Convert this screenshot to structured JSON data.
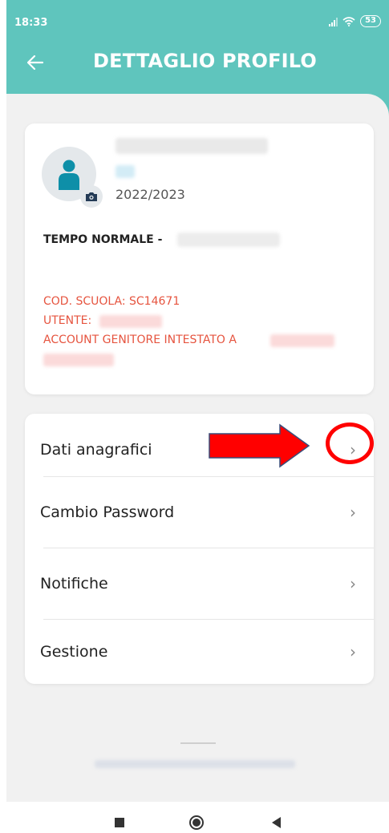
{
  "status_bar": {
    "time": "18:33",
    "battery": "53"
  },
  "app_bar": {
    "title": "DETTAGLIO PROFILO"
  },
  "profile": {
    "school_year": "2022/2023",
    "schedule_label": "TEMPO NORMALE -",
    "school_code": "COD. SCUOLA: SC14671",
    "user_label": "UTENTE:",
    "account_label": "ACCOUNT GENITORE INTESTATO A"
  },
  "menu": {
    "items": [
      {
        "label": "Dati anagrafici",
        "chevron": "›"
      },
      {
        "label": "Cambio Password",
        "chevron": "›"
      },
      {
        "label": "Notifiche",
        "chevron": "›"
      },
      {
        "label": "Gestione",
        "chevron": "›"
      }
    ]
  },
  "colors": {
    "header": "#5fc5bd",
    "accent_text": "#e6543f",
    "annotation": "#ff0000"
  },
  "icons": [
    "back-arrow-icon",
    "person-icon",
    "camera-icon",
    "chevron-right-icon",
    "signal-icon",
    "wifi-icon",
    "battery-icon"
  ]
}
